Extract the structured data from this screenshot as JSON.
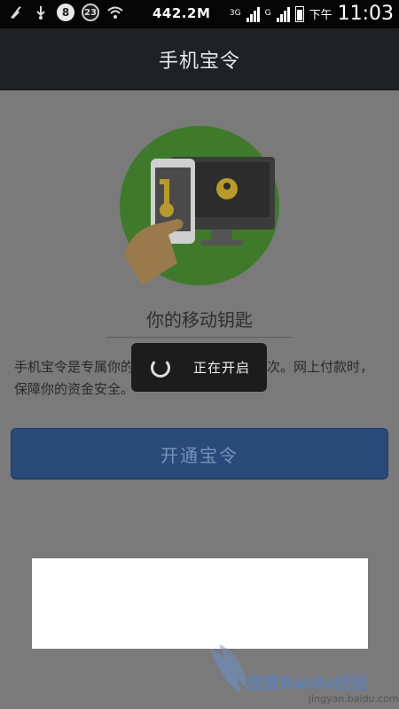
{
  "status_bar": {
    "notification_count": "8",
    "badge_count": "23",
    "network_speed": "442.2M",
    "network_3g": "3G",
    "network_g": "G",
    "ampm": "下午",
    "time": "11:03"
  },
  "app": {
    "title": "手机宝令"
  },
  "main": {
    "subtitle": "你的移动钥匙",
    "description": "手机宝令是专属你的动态密码，每秒变换一次。网上付款时，保障你的资金安全。",
    "primary_button_label": "开通宝令"
  },
  "toast": {
    "text": "正在开启"
  },
  "watermark": {
    "text": "我爱Baidu经验",
    "url": "jingyan.baidu.com"
  },
  "colors": {
    "title_bar": "#1f2124",
    "dim_overlay": "#7a7a7a",
    "primary_button": "#2a4a7a",
    "illustration_green": "#3e7a2a",
    "key_yellow": "#b89a2a"
  },
  "icons": [
    "usb-icon",
    "notification-icon",
    "badge-icon",
    "wifi-icon",
    "signal-icon",
    "battery-icon",
    "spinner-icon",
    "key-icon",
    "phone-icon",
    "monitor-icon"
  ]
}
